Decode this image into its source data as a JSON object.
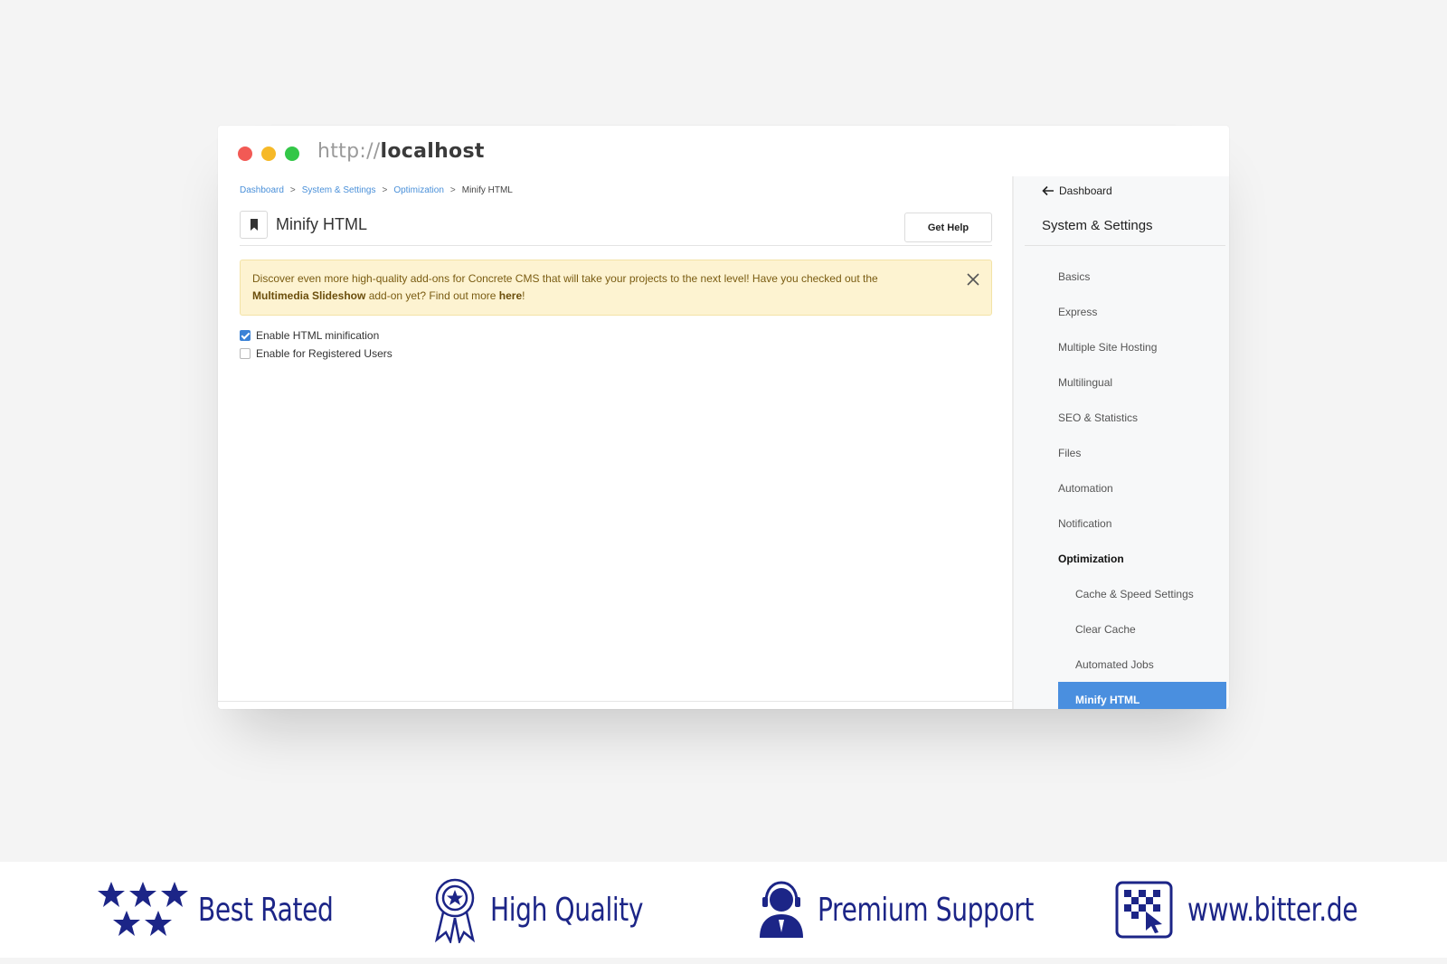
{
  "browser": {
    "url_protocol": "http://",
    "url_host": "localhost"
  },
  "breadcrumb": {
    "items": [
      "Dashboard",
      "System & Settings",
      "Optimization"
    ],
    "separator": ">",
    "current": "Minify HTML"
  },
  "header": {
    "title": "Minify HTML",
    "help_label": "Get Help"
  },
  "alert": {
    "text_1": "Discover even more high-quality add-ons for Concrete CMS that will take your projects to the next level! Have you checked out the",
    "link_addon": "Multimedia Slideshow",
    "text_2": "add-on yet? Find out more",
    "link_here": "here",
    "text_3": "!"
  },
  "options": [
    {
      "label": "Enable HTML minification",
      "checked": true
    },
    {
      "label": "Enable for Registered Users",
      "checked": false
    }
  ],
  "sidebar": {
    "back_label": "Dashboard",
    "title": "System & Settings",
    "items": [
      {
        "label": "Basics"
      },
      {
        "label": "Express"
      },
      {
        "label": "Multiple Site Hosting"
      },
      {
        "label": "Multilingual"
      },
      {
        "label": "SEO & Statistics"
      },
      {
        "label": "Files"
      },
      {
        "label": "Automation"
      },
      {
        "label": "Notification"
      },
      {
        "label": "Optimization"
      },
      {
        "label": "Cache & Speed Settings"
      },
      {
        "label": "Clear Cache"
      },
      {
        "label": "Automated Jobs"
      },
      {
        "label": "Minify HTML"
      }
    ]
  },
  "footer": {
    "badges": [
      "Best Rated",
      "High Quality",
      "Premium Support",
      "www.bitter.de"
    ],
    "brand_color": "#1c2587"
  },
  "colors": {
    "accent": "#4a8fdf",
    "alert_bg": "#fdf3d1",
    "link": "#4a90d9"
  }
}
